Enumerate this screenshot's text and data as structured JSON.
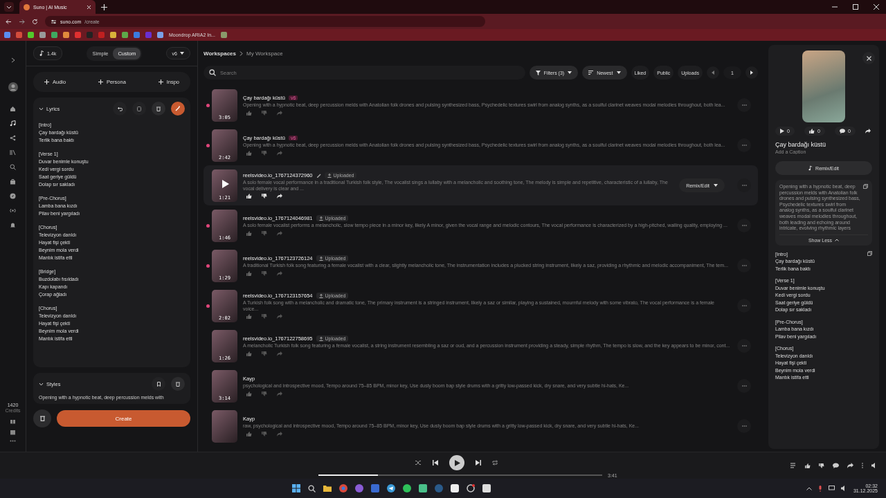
{
  "browser": {
    "tab_title": "Suno | AI Music",
    "url_host": "suno.com",
    "url_path": "/create",
    "bookmarks": [
      {
        "kind": "icon",
        "color": "#5b8def"
      },
      {
        "kind": "icon",
        "color": "#d44c3c"
      },
      {
        "kind": "icon",
        "color": "#53c92b"
      },
      {
        "kind": "icon",
        "color": "#9a9a9a"
      },
      {
        "kind": "icon",
        "color": "#3fa860"
      },
      {
        "kind": "icon",
        "color": "#e08a3c"
      },
      {
        "kind": "icon",
        "color": "#e03030"
      },
      {
        "kind": "icon",
        "color": "#222222"
      },
      {
        "kind": "icon",
        "color": "#c02020"
      },
      {
        "kind": "icon",
        "color": "#d9b23a"
      },
      {
        "kind": "icon",
        "color": "#5ea84a"
      },
      {
        "kind": "icon",
        "color": "#3b7be0"
      },
      {
        "kind": "icon",
        "color": "#6a2fd0"
      },
      {
        "kind": "icon",
        "color": "#7aa0e8"
      },
      {
        "kind": "link",
        "label": "Moondrop ARIA2 In..."
      },
      {
        "kind": "icon",
        "color": "#8a9a6a"
      }
    ]
  },
  "rail": {
    "credits": "1420",
    "credits_label": "Credits"
  },
  "create": {
    "credits_badge": "1.4k",
    "modes": [
      {
        "label": "Simple",
        "selected": false
      },
      {
        "label": "Custom",
        "selected": true
      }
    ],
    "version": "v6",
    "add_buttons": [
      "Audio",
      "Persona",
      "Inspo"
    ],
    "lyrics": {
      "title": "Lyrics",
      "expanded": true,
      "sections": [
        [
          "[Intro]",
          "Çay bardağı küstü",
          "Terlik bana baktı"
        ],
        [
          "[Verse 1]",
          "Duvar benimle konuştu",
          "Kedi vergi sordu",
          "Saat geriye güldü",
          "Dolap sır sakladı"
        ],
        [
          "[Pre-Chorus]",
          "Lamba bana kızdı",
          "Pilav beni yargıladı"
        ],
        [
          "[Chorus]",
          "Televizyon darıldı",
          "Hayat fişi çekti",
          "Beynim mola verdi",
          "Mantık istifa etti"
        ],
        [
          "[Bridge]",
          "Buzdolabı fısıldadı",
          "Kapı kapandı",
          "Çorap ağladı"
        ],
        [
          "[Chorus]",
          "Televizyon darıldı",
          "Hayat fişi çekti",
          "Beynim mola verdi",
          "Mantık istifa etti"
        ]
      ]
    },
    "styles": {
      "title": "Styles",
      "expanded": true,
      "text": "Opening with a hypnotic beat, deep percussion melds with"
    },
    "create_button": "Create"
  },
  "main": {
    "breadcrumb": [
      "Workspaces",
      "My Workspace"
    ],
    "search": {
      "placeholder": "Search"
    },
    "filters": "Filters (3)",
    "sort": "Newest",
    "chips": [
      "Liked",
      "Public",
      "Uploads"
    ],
    "page": "1",
    "songs": [
      {
        "title": "Çay bardağı küstü",
        "tag": {
          "kind": "version",
          "label": "v6"
        },
        "duration": "3:05",
        "unread": true,
        "hovered": false,
        "description": "Opening with a hypnotic beat, deep percussion melds with Anatolian folk drones and pulsing synthesized bass, Psychedelic textures swirl from analog synths, as a soulful clarinet weaves modal melodies throughout, both lea..."
      },
      {
        "title": "Çay bardağı küstü",
        "tag": {
          "kind": "version",
          "label": "v6"
        },
        "duration": "2:42",
        "unread": true,
        "hovered": false,
        "description": "Opening with a hypnotic beat, deep percussion melds with Anatolian folk drones and pulsing synthesized bass, Psychedelic textures swirl from analog synths, as a soulful clarinet weaves modal melodies throughout, both lea..."
      },
      {
        "title": "reelsvideo.io_1767124372960",
        "tag": {
          "kind": "upload",
          "label": "Uploaded"
        },
        "duration": "1:21",
        "unread": false,
        "hovered": true,
        "remix": "Remix/Edit",
        "description": "A solo female vocal performance in a traditional Turkish folk style, The vocalist sings a lullaby with a melancholic and soothing tone, The melody is simple and repetitive, characteristic of a lullaby, The vocal delivery is clear and ..."
      },
      {
        "title": "reelsvideo.io_1767124046981",
        "tag": {
          "kind": "upload",
          "label": "Uploaded"
        },
        "duration": "1:46",
        "unread": true,
        "hovered": false,
        "description": "A solo female vocalist performs a melancholic, slow tempo piece in a minor key, likely A minor, given the vocal range and melodic contours, The vocal performance is characterized by a high-pitched, wailing quality, employing ..."
      },
      {
        "title": "reelsvideo.io_1767123726124",
        "tag": {
          "kind": "upload",
          "label": "Uploaded"
        },
        "duration": "1:29",
        "unread": true,
        "hovered": false,
        "description": "A traditional Turkish folk song featuring a female vocalist with a clear, slightly melancholic tone, The instrumentation includes a plucked string instrument, likely a saz, providing a rhythmic and melodic accompaniment, The tem..."
      },
      {
        "title": "reelsvideo.io_1767123157654",
        "tag": {
          "kind": "upload",
          "label": "Uploaded"
        },
        "duration": "2:02",
        "unread": true,
        "hovered": false,
        "description": "A Turkish folk song with a melancholic and dramatic tone, The primary instrument is a stringed instrument, likely a saz or similar, playing a sustained, mournful melody with some vibrato, The vocal performance is a female voice..."
      },
      {
        "title": "reelsvideo.io_1767122758695",
        "tag": {
          "kind": "upload",
          "label": "Uploaded"
        },
        "duration": "1:26",
        "unread": false,
        "hovered": false,
        "description": "A melancholic Turkish folk song featuring a female vocalist, a string instrument resembling a saz or oud, and a percussion instrument providing a steady, simple rhythm, The tempo is slow, and the key appears to be minor, cont..."
      },
      {
        "title": "Kayp",
        "duration": "3:14",
        "unread": false,
        "hovered": false,
        "description": "psychological and introspective mood, Tempo around 75–85 BPM, minor key, Use dusty boom bap style drums with a gritty low-passed kick, dry snare, and very subtle hi-hats, Ke..."
      },
      {
        "title": "Kayp",
        "unread": false,
        "hovered": false,
        "description": "raw, psychological and introspective mood, Tempo around 75–85 BPM, minor key, Use dusty boom bap style drums with a gritty low-passed kick, dry snare, and very subtle hi-hats, Ke..."
      }
    ]
  },
  "detail": {
    "plays": "0",
    "likes": "0",
    "comments": "0",
    "title": "Çay bardağı küstü",
    "caption_placeholder": "Add a Caption",
    "remix": "Remix/Edit",
    "description": "Opening with a hypnotic beat, deep percussion melds with Anatolian folk drones and pulsing synthesized bass, Psychedelic textures swirl from analog synths, as a soulful clarinet weaves modal melodies throughout, both leading and echoing around intricate, evolving rhythmic layers",
    "toggle": "Show Less",
    "lyrics": [
      [
        "[Intro]",
        "Çay bardağı küstü",
        "Terlik bana baktı"
      ],
      [
        "[Verse 1]",
        "Duvar benimle konuştu",
        "Kedi vergi sordu",
        "Saat geriye güldü",
        "Dolap sır sakladı"
      ],
      [
        "[Pre-Chorus]",
        "Lamba bana kızdı",
        "Pilav beni yargıladı"
      ],
      [
        "[Chorus]",
        "Televizyon darıldı",
        "Hayat fişi çekti",
        "Beynim mola verdi",
        "Mantık istifa etti"
      ]
    ]
  },
  "player": {
    "level": 0.21,
    "time": "3:41",
    "playing": false
  },
  "taskbar": {
    "time": "02:32",
    "date": "31.12.2025"
  }
}
